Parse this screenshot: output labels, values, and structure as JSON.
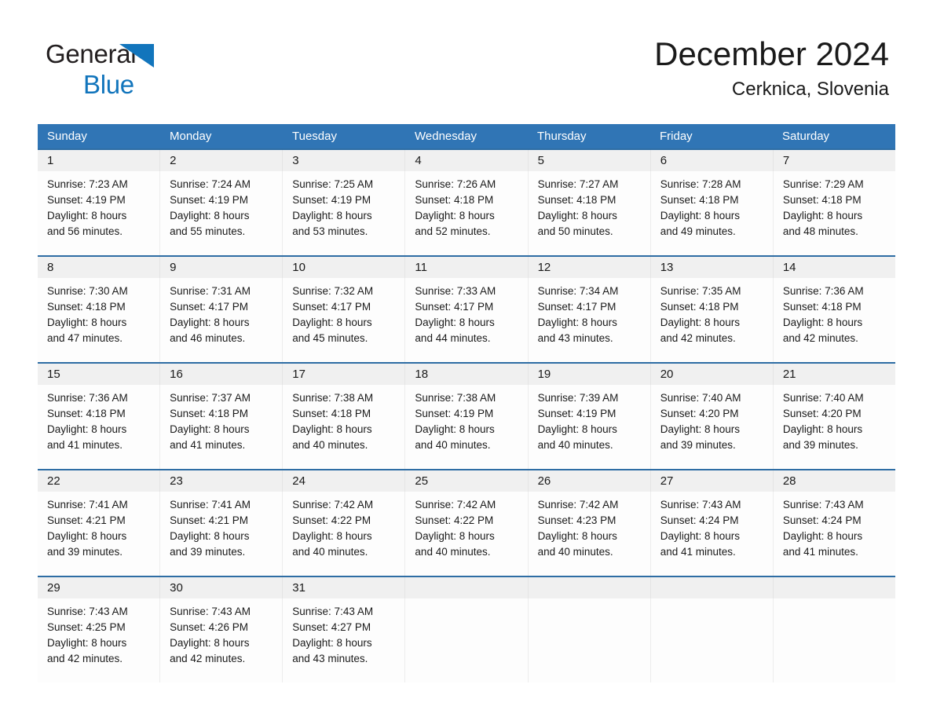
{
  "brand": {
    "name_part1": "General",
    "name_part2": "Blue",
    "triangle_color": "#1275bc",
    "text_color": "#231f20"
  },
  "header": {
    "title": "December 2024",
    "location": "Cerknica, Slovenia",
    "header_bg_color": "#3075b5",
    "row_separator_color": "#2e6da4",
    "daynum_band_color": "#f0f0f0"
  },
  "weekday_headers": [
    "Sunday",
    "Monday",
    "Tuesday",
    "Wednesday",
    "Thursday",
    "Friday",
    "Saturday"
  ],
  "weeks": [
    {
      "daynums": [
        "1",
        "2",
        "3",
        "4",
        "5",
        "6",
        "7"
      ],
      "cells": [
        {
          "sunrise": "Sunrise: 7:23 AM",
          "sunset": "Sunset: 4:19 PM",
          "daylight1": "Daylight: 8 hours",
          "daylight2": "and 56 minutes."
        },
        {
          "sunrise": "Sunrise: 7:24 AM",
          "sunset": "Sunset: 4:19 PM",
          "daylight1": "Daylight: 8 hours",
          "daylight2": "and 55 minutes."
        },
        {
          "sunrise": "Sunrise: 7:25 AM",
          "sunset": "Sunset: 4:19 PM",
          "daylight1": "Daylight: 8 hours",
          "daylight2": "and 53 minutes."
        },
        {
          "sunrise": "Sunrise: 7:26 AM",
          "sunset": "Sunset: 4:18 PM",
          "daylight1": "Daylight: 8 hours",
          "daylight2": "and 52 minutes."
        },
        {
          "sunrise": "Sunrise: 7:27 AM",
          "sunset": "Sunset: 4:18 PM",
          "daylight1": "Daylight: 8 hours",
          "daylight2": "and 50 minutes."
        },
        {
          "sunrise": "Sunrise: 7:28 AM",
          "sunset": "Sunset: 4:18 PM",
          "daylight1": "Daylight: 8 hours",
          "daylight2": "and 49 minutes."
        },
        {
          "sunrise": "Sunrise: 7:29 AM",
          "sunset": "Sunset: 4:18 PM",
          "daylight1": "Daylight: 8 hours",
          "daylight2": "and 48 minutes."
        }
      ]
    },
    {
      "daynums": [
        "8",
        "9",
        "10",
        "11",
        "12",
        "13",
        "14"
      ],
      "cells": [
        {
          "sunrise": "Sunrise: 7:30 AM",
          "sunset": "Sunset: 4:18 PM",
          "daylight1": "Daylight: 8 hours",
          "daylight2": "and 47 minutes."
        },
        {
          "sunrise": "Sunrise: 7:31 AM",
          "sunset": "Sunset: 4:17 PM",
          "daylight1": "Daylight: 8 hours",
          "daylight2": "and 46 minutes."
        },
        {
          "sunrise": "Sunrise: 7:32 AM",
          "sunset": "Sunset: 4:17 PM",
          "daylight1": "Daylight: 8 hours",
          "daylight2": "and 45 minutes."
        },
        {
          "sunrise": "Sunrise: 7:33 AM",
          "sunset": "Sunset: 4:17 PM",
          "daylight1": "Daylight: 8 hours",
          "daylight2": "and 44 minutes."
        },
        {
          "sunrise": "Sunrise: 7:34 AM",
          "sunset": "Sunset: 4:17 PM",
          "daylight1": "Daylight: 8 hours",
          "daylight2": "and 43 minutes."
        },
        {
          "sunrise": "Sunrise: 7:35 AM",
          "sunset": "Sunset: 4:18 PM",
          "daylight1": "Daylight: 8 hours",
          "daylight2": "and 42 minutes."
        },
        {
          "sunrise": "Sunrise: 7:36 AM",
          "sunset": "Sunset: 4:18 PM",
          "daylight1": "Daylight: 8 hours",
          "daylight2": "and 42 minutes."
        }
      ]
    },
    {
      "daynums": [
        "15",
        "16",
        "17",
        "18",
        "19",
        "20",
        "21"
      ],
      "cells": [
        {
          "sunrise": "Sunrise: 7:36 AM",
          "sunset": "Sunset: 4:18 PM",
          "daylight1": "Daylight: 8 hours",
          "daylight2": "and 41 minutes."
        },
        {
          "sunrise": "Sunrise: 7:37 AM",
          "sunset": "Sunset: 4:18 PM",
          "daylight1": "Daylight: 8 hours",
          "daylight2": "and 41 minutes."
        },
        {
          "sunrise": "Sunrise: 7:38 AM",
          "sunset": "Sunset: 4:18 PM",
          "daylight1": "Daylight: 8 hours",
          "daylight2": "and 40 minutes."
        },
        {
          "sunrise": "Sunrise: 7:38 AM",
          "sunset": "Sunset: 4:19 PM",
          "daylight1": "Daylight: 8 hours",
          "daylight2": "and 40 minutes."
        },
        {
          "sunrise": "Sunrise: 7:39 AM",
          "sunset": "Sunset: 4:19 PM",
          "daylight1": "Daylight: 8 hours",
          "daylight2": "and 40 minutes."
        },
        {
          "sunrise": "Sunrise: 7:40 AM",
          "sunset": "Sunset: 4:20 PM",
          "daylight1": "Daylight: 8 hours",
          "daylight2": "and 39 minutes."
        },
        {
          "sunrise": "Sunrise: 7:40 AM",
          "sunset": "Sunset: 4:20 PM",
          "daylight1": "Daylight: 8 hours",
          "daylight2": "and 39 minutes."
        }
      ]
    },
    {
      "daynums": [
        "22",
        "23",
        "24",
        "25",
        "26",
        "27",
        "28"
      ],
      "cells": [
        {
          "sunrise": "Sunrise: 7:41 AM",
          "sunset": "Sunset: 4:21 PM",
          "daylight1": "Daylight: 8 hours",
          "daylight2": "and 39 minutes."
        },
        {
          "sunrise": "Sunrise: 7:41 AM",
          "sunset": "Sunset: 4:21 PM",
          "daylight1": "Daylight: 8 hours",
          "daylight2": "and 39 minutes."
        },
        {
          "sunrise": "Sunrise: 7:42 AM",
          "sunset": "Sunset: 4:22 PM",
          "daylight1": "Daylight: 8 hours",
          "daylight2": "and 40 minutes."
        },
        {
          "sunrise": "Sunrise: 7:42 AM",
          "sunset": "Sunset: 4:22 PM",
          "daylight1": "Daylight: 8 hours",
          "daylight2": "and 40 minutes."
        },
        {
          "sunrise": "Sunrise: 7:42 AM",
          "sunset": "Sunset: 4:23 PM",
          "daylight1": "Daylight: 8 hours",
          "daylight2": "and 40 minutes."
        },
        {
          "sunrise": "Sunrise: 7:43 AM",
          "sunset": "Sunset: 4:24 PM",
          "daylight1": "Daylight: 8 hours",
          "daylight2": "and 41 minutes."
        },
        {
          "sunrise": "Sunrise: 7:43 AM",
          "sunset": "Sunset: 4:24 PM",
          "daylight1": "Daylight: 8 hours",
          "daylight2": "and 41 minutes."
        }
      ]
    },
    {
      "daynums": [
        "29",
        "30",
        "31",
        "",
        "",
        "",
        ""
      ],
      "cells": [
        {
          "sunrise": "Sunrise: 7:43 AM",
          "sunset": "Sunset: 4:25 PM",
          "daylight1": "Daylight: 8 hours",
          "daylight2": "and 42 minutes."
        },
        {
          "sunrise": "Sunrise: 7:43 AM",
          "sunset": "Sunset: 4:26 PM",
          "daylight1": "Daylight: 8 hours",
          "daylight2": "and 42 minutes."
        },
        {
          "sunrise": "Sunrise: 7:43 AM",
          "sunset": "Sunset: 4:27 PM",
          "daylight1": "Daylight: 8 hours",
          "daylight2": "and 43 minutes."
        },
        {
          "sunrise": "",
          "sunset": "",
          "daylight1": "",
          "daylight2": ""
        },
        {
          "sunrise": "",
          "sunset": "",
          "daylight1": "",
          "daylight2": ""
        },
        {
          "sunrise": "",
          "sunset": "",
          "daylight1": "",
          "daylight2": ""
        },
        {
          "sunrise": "",
          "sunset": "",
          "daylight1": "",
          "daylight2": ""
        }
      ]
    }
  ]
}
